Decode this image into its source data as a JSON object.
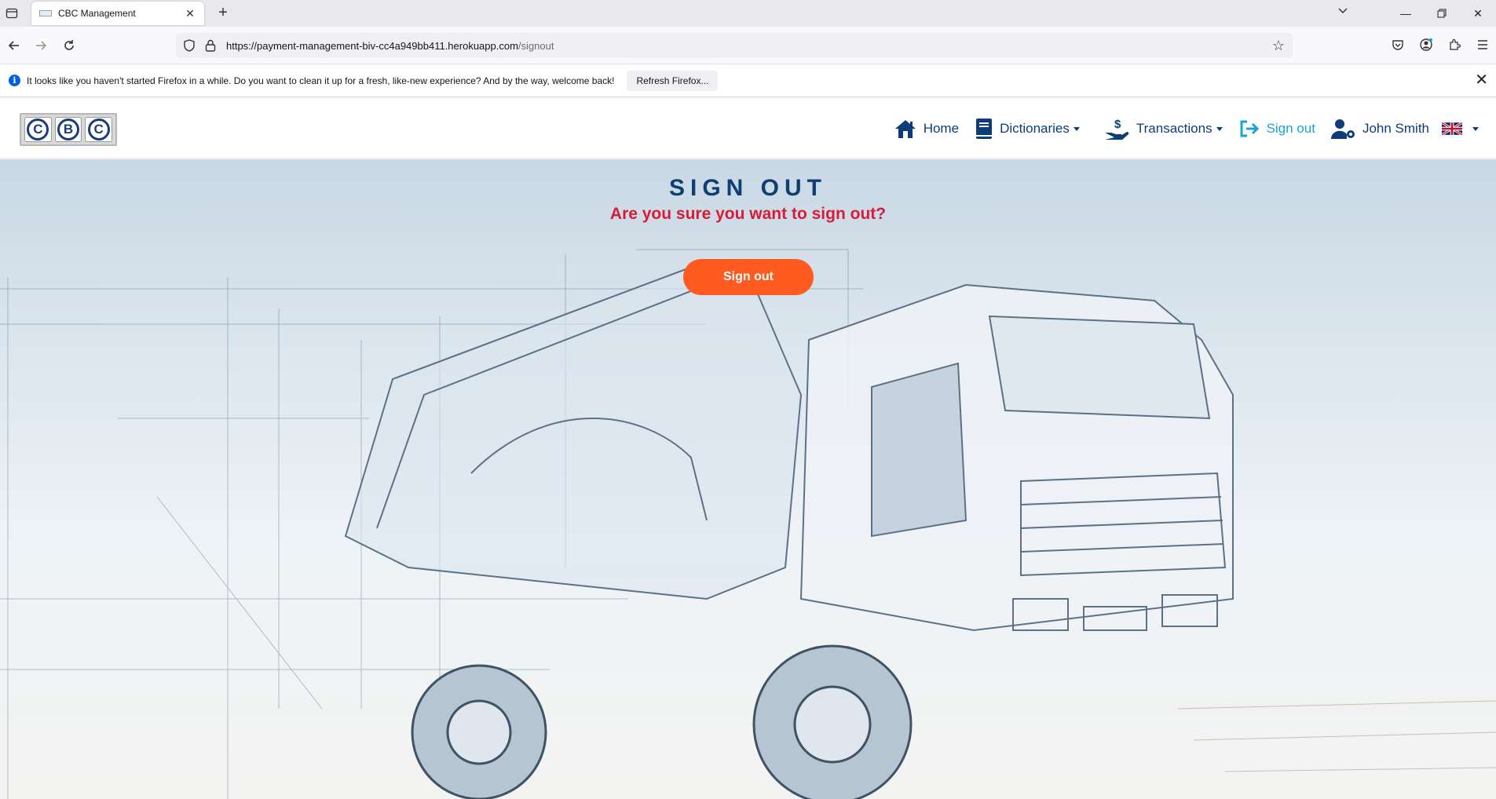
{
  "browser": {
    "tab_title": "CBC Management",
    "url_main": "https://payment-management-biv-cc4a949bb411.herokuapp.com",
    "url_path": "/signout"
  },
  "notification": {
    "message": "It looks like you haven't started Firefox in a while. Do you want to clean it up for a fresh, like-new experience? And by the way, welcome back!",
    "button": "Refresh Firefox..."
  },
  "app": {
    "logo_letters": [
      "C",
      "B",
      "C"
    ],
    "nav": {
      "home": "Home",
      "dictionaries": "Dictionaries",
      "transactions": "Transactions",
      "signout": "Sign out",
      "user": "John Smith"
    }
  },
  "page": {
    "title": "SIGN OUT",
    "question": "Are you sure you want to sign out?",
    "button": "Sign out"
  },
  "colors": {
    "brand_blue": "#0c3d78",
    "signout_accent": "#1aa3d6",
    "button_orange": "#ff5a1f",
    "question_red": "#d81b37"
  }
}
